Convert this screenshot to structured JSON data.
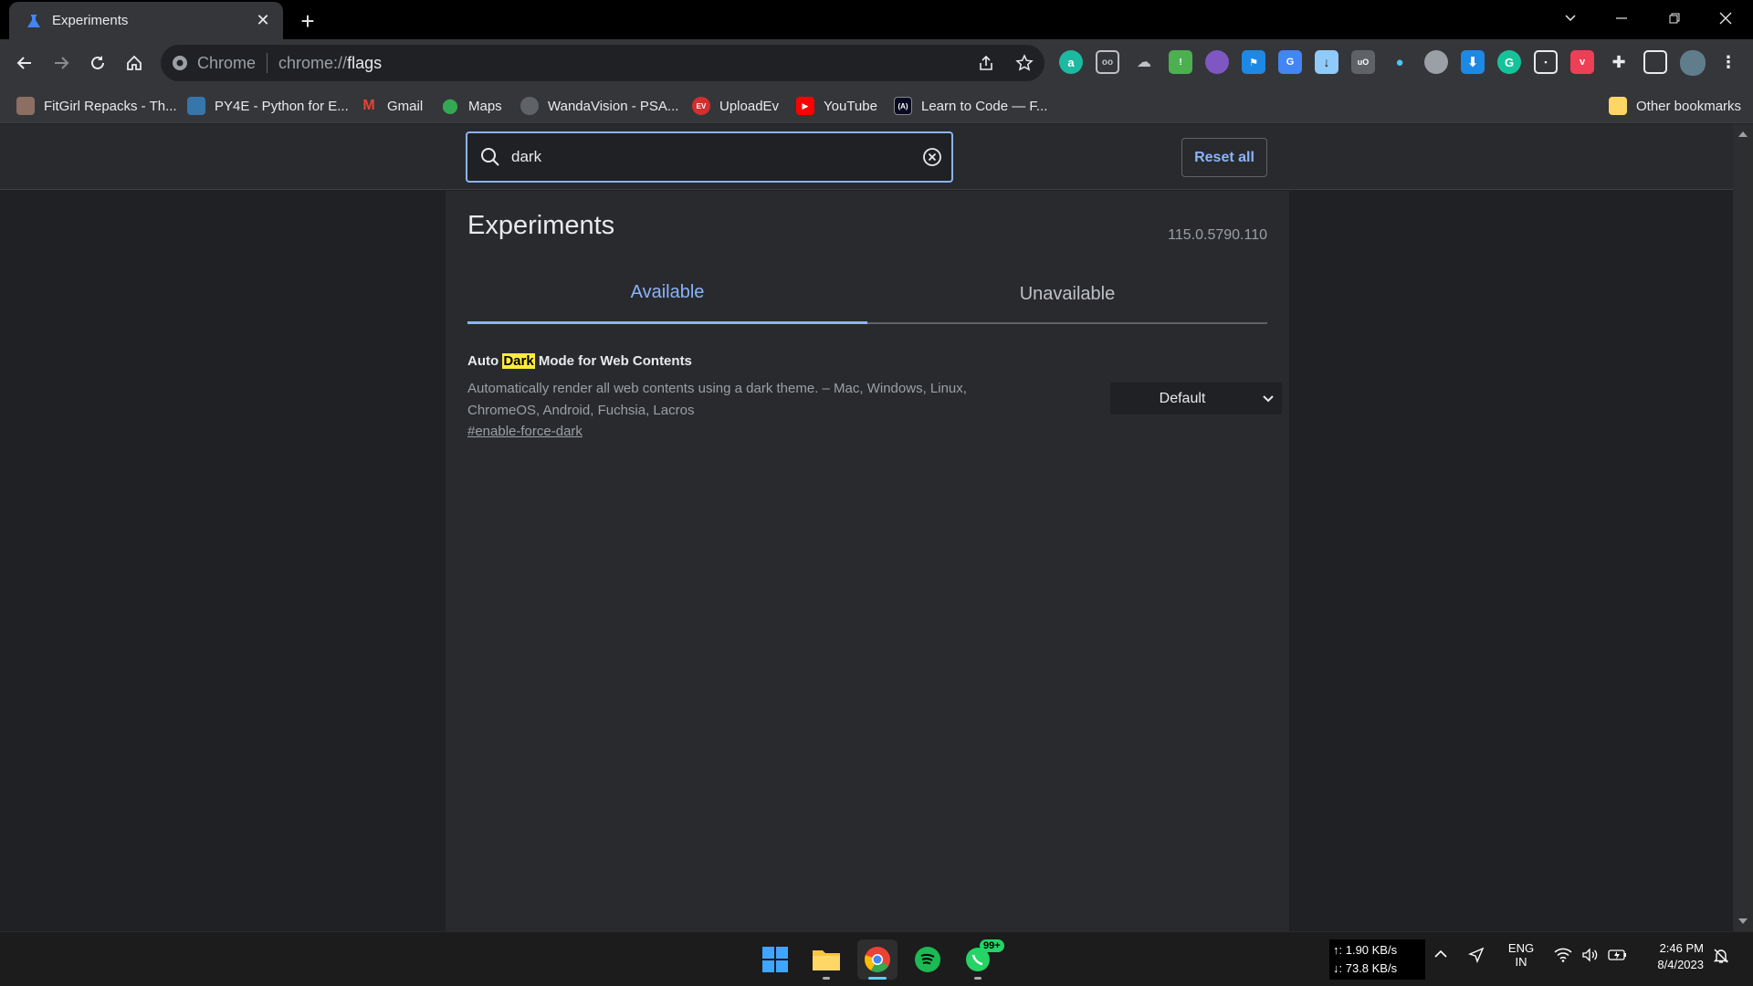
{
  "browser": {
    "tab_title": "Experiments",
    "omnibox_chip": "Chrome",
    "url_prefix": "chrome://",
    "url_path": "flags"
  },
  "bookmarks": [
    {
      "label": "FitGirl Repacks - Th...",
      "icon": "fitgirl-icon",
      "color": "#8d6e63"
    },
    {
      "label": "PY4E - Python for E...",
      "icon": "python-icon",
      "color": "#3776ab"
    },
    {
      "label": "Gmail",
      "icon": "gmail-icon",
      "color": "#ea4335"
    },
    {
      "label": "Maps",
      "icon": "maps-icon",
      "color": "#34a853"
    },
    {
      "label": "WandaVision - PSA...",
      "icon": "globe-icon",
      "color": "#5f6368"
    },
    {
      "label": "UploadEv",
      "icon": "uploadev-icon",
      "color": "#d32f2f"
    },
    {
      "label": "YouTube",
      "icon": "youtube-icon",
      "color": "#ff0000"
    },
    {
      "label": "Learn to Code — F...",
      "icon": "freecodecamp-icon",
      "color": "#0a0a23"
    }
  ],
  "other_bookmarks": "Other bookmarks",
  "flags_page": {
    "search_value": "dark",
    "reset_label": "Reset all",
    "title": "Experiments",
    "version": "115.0.5790.110",
    "tabs": [
      "Available",
      "Unavailable"
    ],
    "flag": {
      "name_before": "Auto ",
      "name_highlight": "Dark",
      "name_after": " Mode for Web Contents",
      "description": "Automatically render all web contents using a dark theme. – Mac, Windows, Linux, ChromeOS, Android, Fuchsia, Lacros",
      "link": "#enable-force-dark",
      "selected": "Default"
    }
  },
  "taskbar": {
    "upload_speed": "↑: 1.90 KB/s",
    "download_speed": "↓: 73.8 KB/s",
    "lang_1": "ENG",
    "lang_2": "IN",
    "time": "2:46 PM",
    "date": "8/4/2023",
    "whatsapp_badge": "99+"
  },
  "colors": {
    "accent": "#8ab4f8",
    "highlight": "#ffeb3b"
  }
}
